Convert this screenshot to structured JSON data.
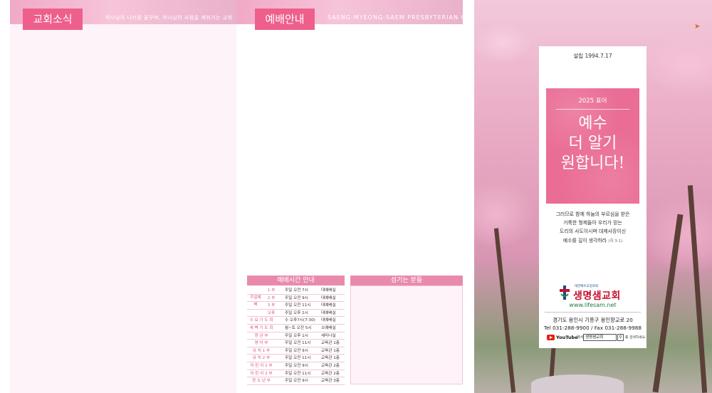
{
  "left_page": {
    "section_title": "교회소식",
    "slogan": "하나님의 나라를 꿈꾸며, 하나님의 사람을 세워가는 교회"
  },
  "middle_page": {
    "section_title": "예배안내",
    "church_name_en": "SAENG-MYEONG-SAEM PRESBYTERIAN CHURCH",
    "schedule_title": "예배시간 안내",
    "hymn_title": "섬기는 분들",
    "sunday_group_label": "주일예배",
    "schedule": [
      {
        "name": "1 부",
        "time": "주일 오전 7시",
        "place": "대예배실"
      },
      {
        "name": "2 부",
        "time": "주일 오전 9시",
        "place": "대예배실"
      },
      {
        "name": "3 부",
        "time": "주일 오전 11시",
        "place": "대예배실"
      },
      {
        "name": "오후",
        "time": "주일 오후 2시",
        "place": "대예배실"
      },
      {
        "name": "수 요 기 도 회",
        "time": "수 오후7시(7:30)",
        "place": "대예배실"
      },
      {
        "name": "새 벽 기 도 회",
        "time": "월~토 오전 5시",
        "place": "소예배실"
      },
      {
        "name": "청 년 부",
        "time": "주일 오후 1시",
        "place": "세미나실"
      },
      {
        "name": "영 아 부",
        "time": "주일 오전 11시",
        "place": "교육관 1층"
      },
      {
        "name": "유 치 1 부",
        "time": "주일 오전 9시",
        "place": "교육관 1층"
      },
      {
        "name": "유 치 2 부",
        "time": "주일 오전 11시",
        "place": "교육관 1층"
      },
      {
        "name": "어 린 이 1 부",
        "time": "주일 오전 9시",
        "place": "교육관 2층"
      },
      {
        "name": "어 린 이 2 부",
        "time": "주일 오전 11시",
        "place": "교육관 2층"
      },
      {
        "name": "청 소 년 부",
        "time": "주일 오전 9시",
        "place": "교육관 3층"
      }
    ]
  },
  "cover": {
    "founded": "설립 1994.7.17",
    "year_label": "2025 표어",
    "theme": "예수\n더 알기\n원합니다!",
    "verse": "그러므로 함께 하늘의 부르심을 받은\n거룩한 형제들아 우리가 믿는\n도리의 사도이시며 대제사장이신\n예수를 깊이 생각하라",
    "verse_ref": "(히 3:1)",
    "denomination": "대한예수교장로회",
    "church_name": "생명샘교회",
    "website": "www.lifesam.net",
    "address": "경기도 용인시 기흥구 용인향교로 20",
    "phone": "Tel 031-288-9900 / Fax 031-288-9988",
    "youtube_label": "YouTube",
    "youtube_suffix": "에서",
    "youtube_search": "생명샘교회",
    "youtube_hint": "를 검색하세요."
  },
  "colors": {
    "accent_pink": "#ee5f8c",
    "soft_pink": "#fdf3f8",
    "logo_red": "#c8102e",
    "logo_blue": "#1a4a8c",
    "website_green": "#1e7a3a"
  }
}
